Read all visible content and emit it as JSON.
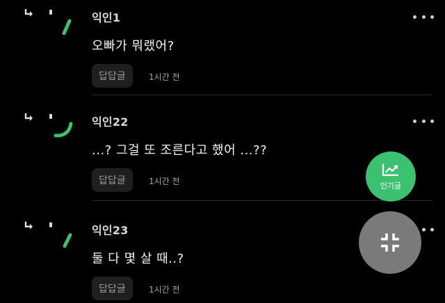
{
  "comments": [
    {
      "author": "익인1",
      "text": "오빠가 뭐랬어?",
      "reply_label": "답답글",
      "time": "1시간 전"
    },
    {
      "author": "익인22",
      "text": "...? 그걸 또 조른다고 했어 ...??",
      "reply_label": "답답글",
      "time": "1시간 전"
    },
    {
      "author": "익인23",
      "text": "둘 다 몇 살 때..?",
      "reply_label": "답답글",
      "time": "1시간 전"
    }
  ],
  "fab": {
    "popular_label": "인기글",
    "popular_icon": "trending-chart-icon",
    "collapse_icon": "collapse-icon"
  },
  "colors": {
    "background": "#000000",
    "accent_green": "#3cc170",
    "collapse_gray": "#7a7a7a",
    "reply_button_bg": "#1f1f1f"
  }
}
